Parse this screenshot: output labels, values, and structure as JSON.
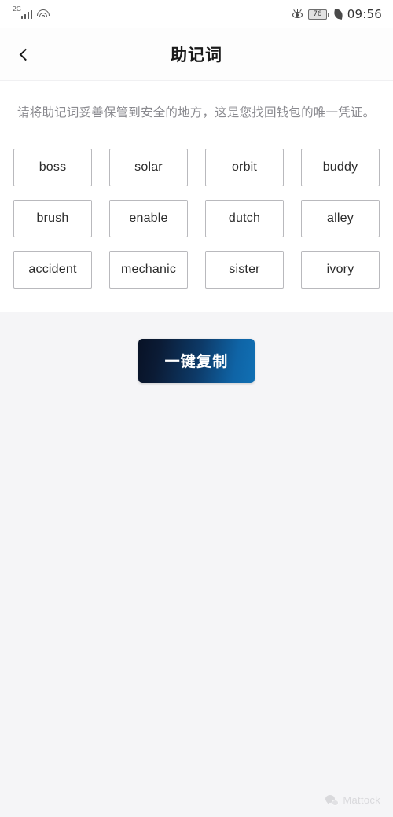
{
  "statusbar": {
    "network_label": "2G",
    "signal_icon": "signal-bars-icon",
    "wifi_icon": "wifi-icon",
    "eye_icon": "eye-comfort-icon",
    "battery_level": "76",
    "powersave_icon": "leaf-powersave-icon",
    "time": "09:56"
  },
  "navbar": {
    "back_icon": "chevron-left-icon",
    "title": "助记词"
  },
  "content": {
    "description": "请将助记词妥善保管到安全的地方，这是您找回钱包的唯一凭证。",
    "mnemonic_words": [
      "boss",
      "solar",
      "orbit",
      "buddy",
      "brush",
      "enable",
      "dutch",
      "alley",
      "accident",
      "mechanic",
      "sister",
      "ivory"
    ]
  },
  "actions": {
    "copy_label": "一键复制",
    "copy_gradient_start": "#081226",
    "copy_gradient_end": "#1070b4"
  },
  "watermark": {
    "logo_icon": "wechat-logo-icon",
    "text": "Mattock"
  }
}
